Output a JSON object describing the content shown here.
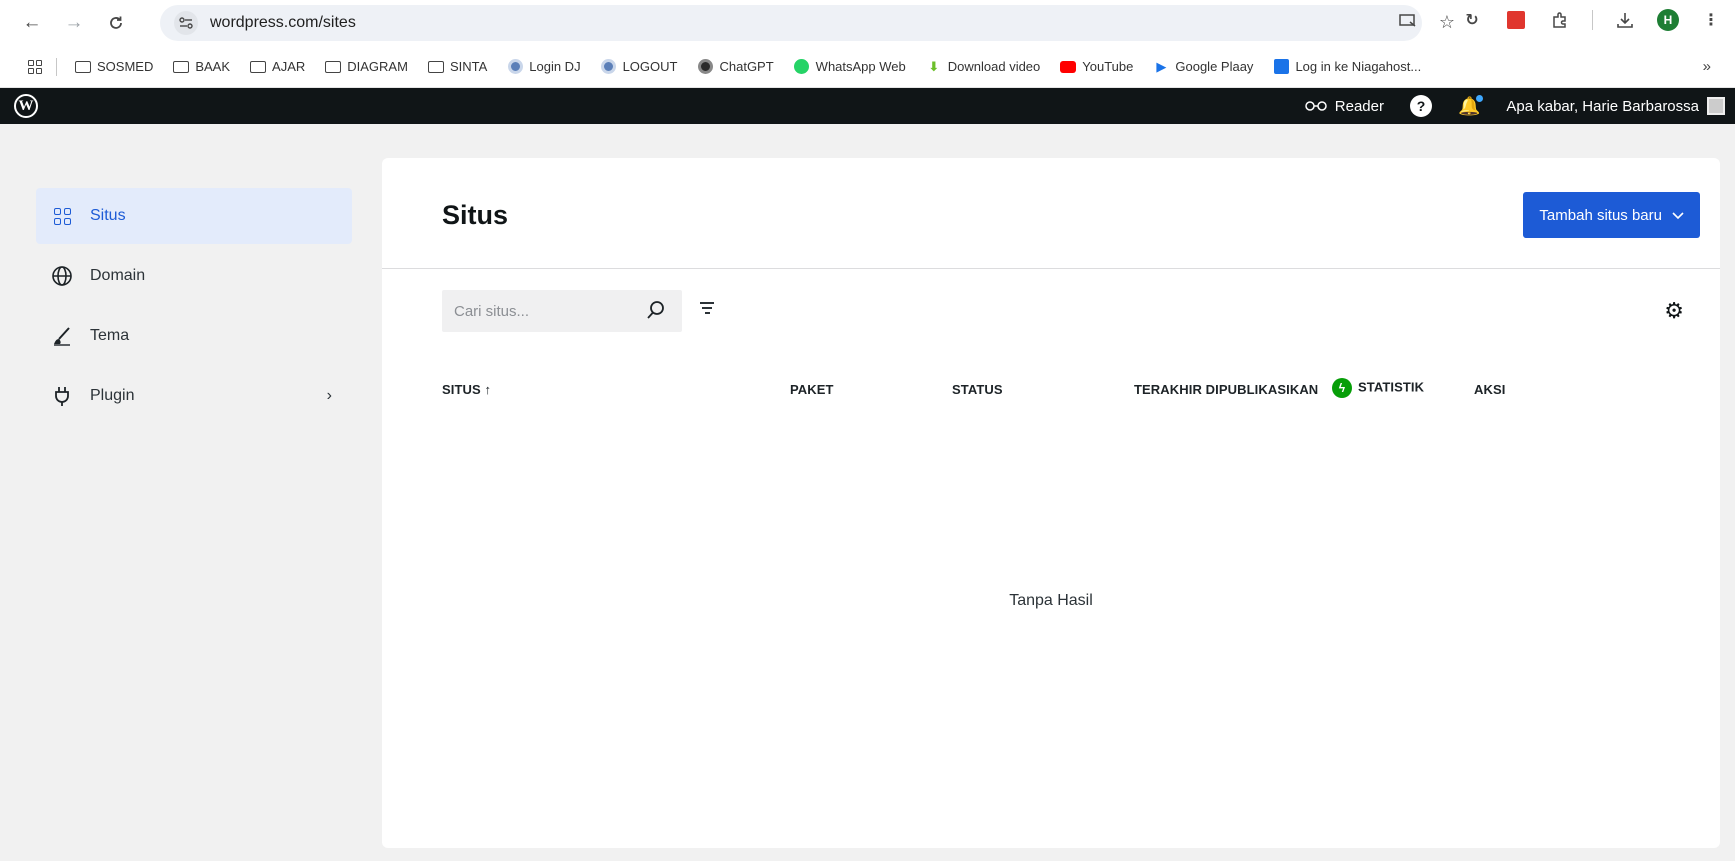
{
  "browser": {
    "url": "wordpress.com/sites",
    "bookmarks": [
      {
        "label": "SOSMED",
        "icon": "folder-icon"
      },
      {
        "label": "BAAK",
        "icon": "folder-icon"
      },
      {
        "label": "AJAR",
        "icon": "folder-icon"
      },
      {
        "label": "DIAGRAM",
        "icon": "folder-icon"
      },
      {
        "label": "SINTA",
        "icon": "folder-icon"
      },
      {
        "label": "Login DJ",
        "icon": "globe-icon"
      },
      {
        "label": "LOGOUT",
        "icon": "globe-icon"
      },
      {
        "label": "ChatGPT",
        "icon": "chatgpt-icon"
      },
      {
        "label": "WhatsApp Web",
        "icon": "whatsapp-icon"
      },
      {
        "label": "Download video",
        "icon": "download-icon"
      },
      {
        "label": "YouTube",
        "icon": "youtube-icon"
      },
      {
        "label": "Google Plaay",
        "icon": "play-icon"
      },
      {
        "label": "Log in ke Niagahost...",
        "icon": "niagahoster-icon"
      }
    ],
    "profile_initial": "H",
    "more_bookmarks": "»"
  },
  "masterbar": {
    "reader_label": "Reader",
    "greeting": "Apa kabar, Harie Barbarossa"
  },
  "sidebar": {
    "items": [
      {
        "label": "Situs",
        "icon": "grid-icon",
        "active": true
      },
      {
        "label": "Domain",
        "icon": "globe-icon"
      },
      {
        "label": "Tema",
        "icon": "brush-icon"
      },
      {
        "label": "Plugin",
        "icon": "plug-icon",
        "has_submenu": true
      }
    ]
  },
  "main": {
    "title": "Situs",
    "add_button": "Tambah situs baru",
    "search_placeholder": "Cari situs...",
    "columns": {
      "site": "SITUS ↑",
      "plan": "PAKET",
      "status": "STATUS",
      "last_published": "TERAKHIR DIPUBLIKASIKAN",
      "stats": "STATISTIK",
      "actions": "AKSI"
    },
    "empty_message": "Tanpa Hasil"
  },
  "colors": {
    "accent": "#1d5bd6",
    "masterbar": "#101517",
    "active_bg": "#e3ebfb",
    "jetpack_green": "#069e08"
  }
}
